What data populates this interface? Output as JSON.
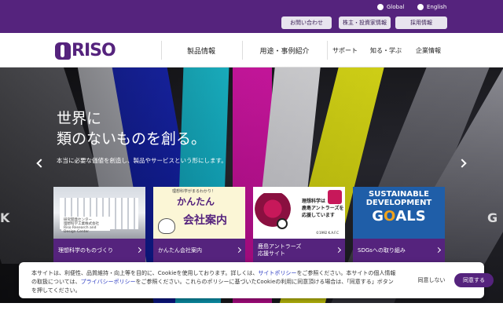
{
  "utility": {
    "global_label": "Global",
    "english_label": "English",
    "contact_label": "お問い合わせ",
    "ir_label": "株主・投資家情報",
    "recruit_label": "採用情報"
  },
  "header": {
    "logo_text": "RISO",
    "nav": {
      "products": "製品情報",
      "cases": "用途・事例紹介",
      "support": "サポート",
      "learn": "知る・学ぶ",
      "company": "企業情報"
    }
  },
  "hero": {
    "headline_line1": "世界に",
    "headline_line2": "類のないものを創る。",
    "subline": "本当に必要な価値を創造し、製品やサービスという形にします。",
    "edge_left": "K",
    "edge_right": "G"
  },
  "cards": [
    {
      "label": "理想科学のものづくり",
      "sign_line1": "研究開発センター",
      "sign_line2": "理想科学工業株式会社",
      "sign_line3": "Riso Research and Design Center"
    },
    {
      "label": "かんたん会社案内",
      "tagline": "理想科学がまるわかり！",
      "title_line1": "かんたん",
      "title_line2": "会社案内"
    },
    {
      "label_line1": "鹿島アントラーズ",
      "label_line2": "応援サイト",
      "text_line1": "理想科学は",
      "text_line2": "鹿島アントラーズを",
      "text_line3": "応援しています",
      "copyright": "©1992 K.A.F.C"
    },
    {
      "label": "SDGsへの取り組み",
      "line1": "SUSTAINABLE",
      "line2": "DEVELOPMENT",
      "goals_g": "G",
      "goals_o": "O",
      "goals_a": "A",
      "goals_l": "L",
      "goals_s": "S"
    }
  ],
  "cookie": {
    "text_part1": "本サイトは、利便性、品質維持・向上等を目的に、Cookieを使用しております。詳しくは、",
    "site_policy": "サイトポリシー",
    "text_part2": "をご参照ください。本サイトの個人情報の取扱については、",
    "privacy_policy": "プライバシーポリシー",
    "text_part3": "をご参照ください。これらのポリシーに基づいたCookieの利用に同意頂ける場合は、「同意する」ボタンを押してください。",
    "decline_label": "同意しない",
    "agree_label": "同意する"
  },
  "colors": {
    "brand_purple": "#55237d",
    "link_blue": "#2a3ac2"
  }
}
